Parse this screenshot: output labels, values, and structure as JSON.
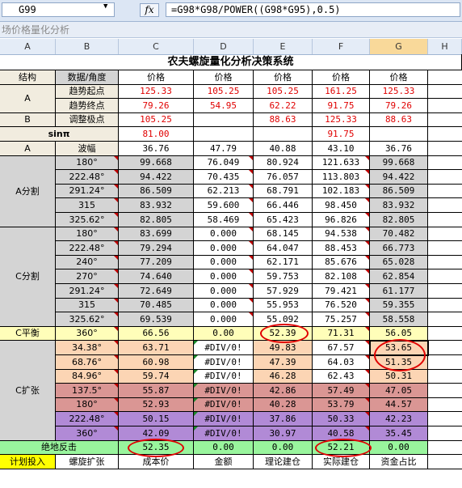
{
  "namebox": "G99",
  "fx_icon": "fx",
  "formula": "=G98*G98/POWER((G98*G95),0.5)",
  "window_title": "场价格量化分析",
  "columns": [
    "A",
    "B",
    "C",
    "D",
    "E",
    "F",
    "G",
    "H"
  ],
  "table_title": "农夫螺旋量化分析决策系统",
  "colors": {
    "gray": "#d4d4d4",
    "beige": "#f1ecdf",
    "yellow": "#fffeb9",
    "peach": "#fcd5b4",
    "rose": "#da9694",
    "purple": "#b18ad6",
    "green": "#99f59d",
    "plan_yellow": "#ffff00",
    "oval": "#e00000"
  },
  "rows": [
    {
      "b": "数据/角度",
      "vals": [
        "价格",
        "价格",
        "价格",
        "价格",
        "价格"
      ]
    },
    {
      "b": "趋势起点",
      "vals": [
        "125.33",
        "105.25",
        "105.25",
        "161.25",
        "125.33"
      ]
    },
    {
      "b": "趋势终点",
      "vals": [
        "79.26",
        "54.95",
        "62.22",
        "91.75",
        "79.26"
      ]
    },
    {
      "b": "调整极点",
      "vals": [
        "105.25",
        "",
        "88.63",
        "125.33",
        "88.63"
      ]
    },
    {
      "b": "",
      "vals": [
        "81.00",
        "",
        "",
        "91.75",
        ""
      ]
    },
    {
      "b": "波幅",
      "vals": [
        "36.76",
        "47.79",
        "40.88",
        "43.10",
        "36.76"
      ]
    },
    {
      "b": "180°",
      "vals": [
        "99.668",
        "76.049",
        "80.924",
        "121.633",
        "99.668"
      ]
    },
    {
      "b": "222.48°",
      "vals": [
        "94.422",
        "70.435",
        "76.057",
        "113.803",
        "94.422"
      ]
    },
    {
      "b": "291.24°",
      "vals": [
        "86.509",
        "62.213",
        "68.791",
        "102.183",
        "86.509"
      ]
    },
    {
      "b": "315",
      "vals": [
        "83.932",
        "59.600",
        "66.446",
        "98.450",
        "83.932"
      ]
    },
    {
      "b": "325.62°",
      "vals": [
        "82.805",
        "58.469",
        "65.423",
        "96.826",
        "82.805"
      ]
    },
    {
      "b": "180°",
      "vals": [
        "83.699",
        "0.000",
        "68.145",
        "94.538",
        "70.482"
      ]
    },
    {
      "b": "222.48°",
      "vals": [
        "79.294",
        "0.000",
        "64.047",
        "88.453",
        "66.773"
      ]
    },
    {
      "b": "240°",
      "vals": [
        "77.209",
        "0.000",
        "62.171",
        "85.676",
        "65.028"
      ]
    },
    {
      "b": "270°",
      "vals": [
        "74.640",
        "0.000",
        "59.753",
        "82.108",
        "62.854"
      ]
    },
    {
      "b": "291.24°",
      "vals": [
        "72.649",
        "0.000",
        "57.929",
        "79.421",
        "61.177"
      ]
    },
    {
      "b": "315",
      "vals": [
        "70.485",
        "0.000",
        "55.953",
        "76.520",
        "59.355"
      ]
    },
    {
      "b": "325.62°",
      "vals": [
        "69.539",
        "0.000",
        "55.092",
        "75.257",
        "58.558"
      ]
    },
    {
      "b": "360°",
      "vals": [
        "66.56",
        "0.00",
        "52.39",
        "71.31",
        "56.05"
      ]
    },
    {
      "b": "34.38°",
      "vals": [
        "63.71",
        "#DIV/0!",
        "49.83",
        "67.57",
        "53.65"
      ]
    },
    {
      "b": "68.76°",
      "vals": [
        "60.98",
        "#DIV/0!",
        "47.39",
        "64.03",
        "51.35"
      ]
    },
    {
      "b": "84.96°",
      "vals": [
        "59.74",
        "#DIV/0!",
        "46.28",
        "62.43",
        "50.31"
      ]
    },
    {
      "b": "137.5°",
      "vals": [
        "55.87",
        "#DIV/0!",
        "42.86",
        "57.49",
        "47.05"
      ]
    },
    {
      "b": "180°",
      "vals": [
        "52.93",
        "#DIV/0!",
        "40.28",
        "53.79",
        "44.57"
      ]
    },
    {
      "b": "222.48°",
      "vals": [
        "50.15",
        "#DIV/0!",
        "37.86",
        "50.33",
        "42.23"
      ]
    },
    {
      "b": "360°",
      "vals": [
        "42.09",
        "#DIV/0!",
        "30.97",
        "40.58",
        "35.45"
      ]
    },
    {
      "b": "",
      "vals": [
        "52.35",
        "0.00",
        "0.00",
        "52.21",
        "0.00"
      ]
    },
    {
      "b": "螺旋扩张",
      "vals": [
        "成本价",
        "金额",
        "理论建仓",
        "实际建仓",
        "资金占比"
      ]
    }
  ],
  "labels": {
    "a1": "结构",
    "a2": "A",
    "a4": "B",
    "a5": "sinπ",
    "a6": "A",
    "a_split": "A分割",
    "c_split": "C分割",
    "c_bal": "C平衡",
    "c_exp": "C扩张",
    "abs": "绝地反击",
    "plan": "计划投入"
  }
}
